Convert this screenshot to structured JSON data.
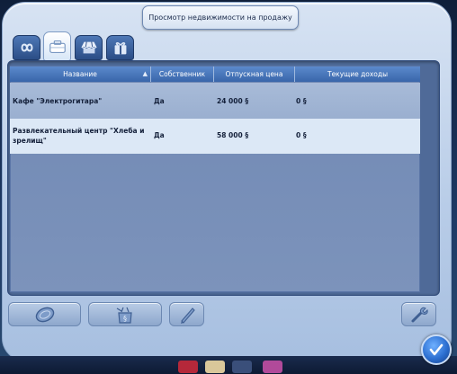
{
  "header": {
    "title": "Просмотр недвижимости на продажу"
  },
  "tabs": [
    {
      "name": "infinity-icon",
      "active": false
    },
    {
      "name": "briefcase-icon",
      "active": true
    },
    {
      "name": "store-awning-icon",
      "active": false
    },
    {
      "name": "gift-box-icon",
      "active": false
    }
  ],
  "table": {
    "columns": [
      "Название",
      "Собственник",
      "Отпускная цена",
      "Текущие доходы"
    ],
    "rows": [
      {
        "name": "Кафе \"Электрогитара\"",
        "owner": "Да",
        "price": "24 000 §",
        "income": "0 §"
      },
      {
        "name": "Развлекательный центр \"Хлеба и зрелищ\"",
        "owner": "Да",
        "price": "58 000 §",
        "income": "0 §"
      }
    ]
  },
  "buttons": {
    "buy_icon": "coin-icon",
    "sell_icon": "sell-bag-icon",
    "edit_icon": "pencil-icon",
    "settings_icon": "wrench-icon",
    "ok_icon": "checkmark-icon"
  },
  "colors": {
    "header_bg": "#3966aa",
    "selected_row_bg": "#dce8f6",
    "row_bg": "#a8bbd8"
  }
}
